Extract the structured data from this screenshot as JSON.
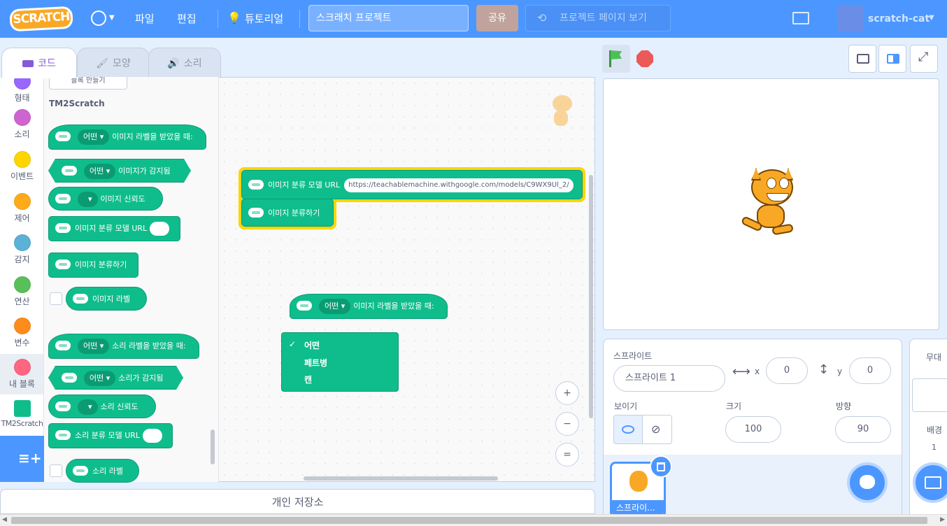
{
  "menubar": {
    "logo": "SCRATCH",
    "file": "파일",
    "edit": "편집",
    "tutorials": "튜토리얼",
    "project_title": "스크래치 프로젝트",
    "share": "공유",
    "see_project_page": "프로젝트 페이지 보기",
    "username": "scratch-cat"
  },
  "tabs": {
    "code": "코드",
    "costumes": "모양",
    "sounds": "소리"
  },
  "categories": [
    {
      "label": "형태",
      "color": "#9966ff"
    },
    {
      "label": "소리",
      "color": "#cf63cf"
    },
    {
      "label": "이벤트",
      "color": "#ffd500"
    },
    {
      "label": "제어",
      "color": "#ffab19"
    },
    {
      "label": "감지",
      "color": "#5cb1d6"
    },
    {
      "label": "연산",
      "color": "#59c059"
    },
    {
      "label": "변수",
      "color": "#ff8c1a"
    },
    {
      "label": "내 블록",
      "color": "#ff6680"
    },
    {
      "label": "TM2Scratch",
      "color": "#0fbd8c"
    }
  ],
  "palette": {
    "make_block_button": "블록 만들기",
    "section_title": "TM2Scratch",
    "b1_dd": "어떤",
    "b1_text": "이미지 라벨을 받았을 때:",
    "b2_dd": "어떤",
    "b2_text": "이미지가 감지됨",
    "b3_text": "이미지 신뢰도",
    "b4_text": "이미지 분류 모델 URL",
    "b5_text": "이미지 분류하기",
    "b6_text": "이미지 라벨",
    "b7_dd": "어떤",
    "b7_text": "소리 라벨을 받았을 때:",
    "b8_dd": "어떤",
    "b8_text": "소리가 감지됨",
    "b9_text": "소리 신뢰도",
    "b10_text": "소리 분류 모델 URL",
    "b11_text": "소리 라벨"
  },
  "workspace": {
    "script1_line1": "이미지 분류 모델 URL",
    "script1_url": "https://teachablemachine.withgoogle.com/models/C9WX9Ul_2/",
    "script1_line2": "이미지 분류하기",
    "script2_dd": "어떤",
    "script2_text": "이미지 라벨을 받았을 때:",
    "dropdown_items": [
      "어떤",
      "페트병",
      "캔"
    ],
    "dropdown_selected": "어떤",
    "zoom_in": "+",
    "zoom_out": "−",
    "zoom_reset": "="
  },
  "backpack": "개인 저장소",
  "sprite_info": {
    "sprite_label": "스프라이트",
    "sprite_name": "스프라이트 1",
    "x_label": "x",
    "x_value": "0",
    "y_label": "y",
    "y_value": "0",
    "show_label": "보이기",
    "size_label": "크기",
    "size_value": "100",
    "direction_label": "방향",
    "direction_value": "90"
  },
  "sprite_list": {
    "thumb_label": "스프라이..."
  },
  "stage_pane": {
    "title": "무대",
    "backdrops_label": "배경",
    "backdrops_count": "1"
  }
}
